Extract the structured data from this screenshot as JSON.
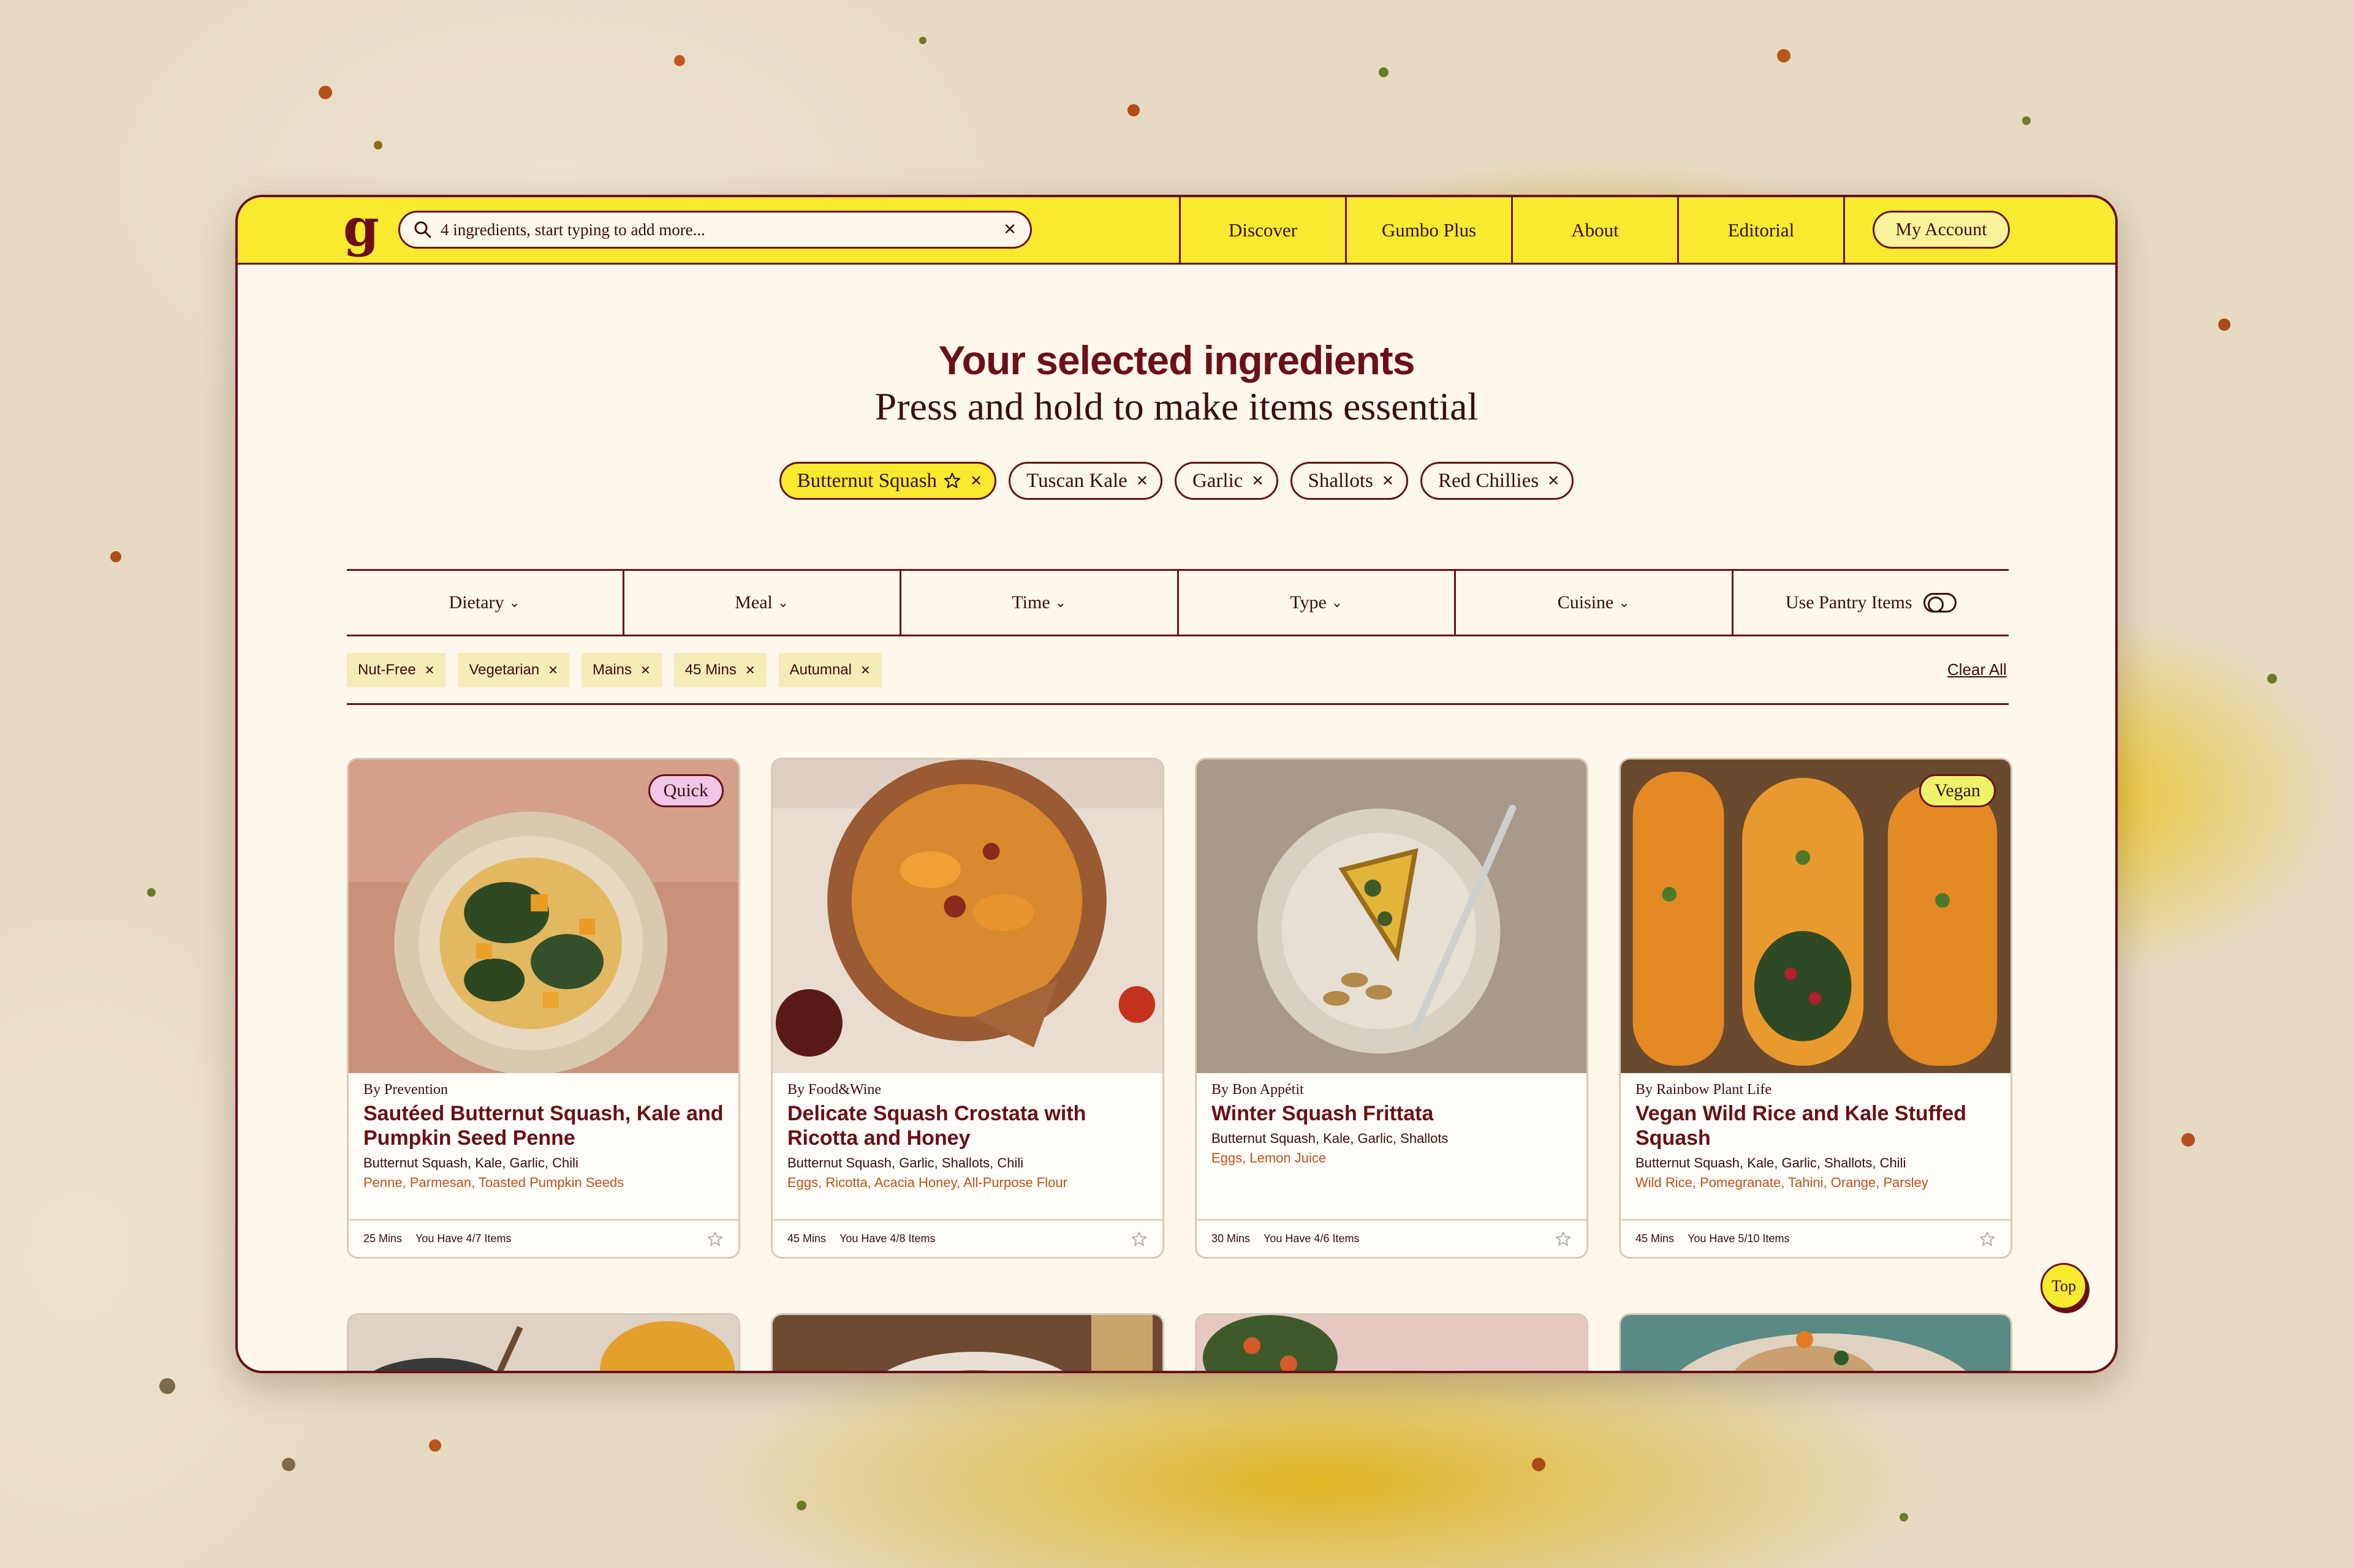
{
  "app": {
    "logo": "g",
    "search_placeholder": "4 ingredients, start typing to add more...",
    "nav": [
      "Discover",
      "Gumbo Plus",
      "About",
      "Editorial"
    ],
    "account_label": "My Account"
  },
  "main": {
    "heading": "Your selected ingredients",
    "subheading": "Press and hold to make items essential",
    "ingredients": [
      {
        "label": "Butternut Squash",
        "essential": true
      },
      {
        "label": "Tuscan Kale"
      },
      {
        "label": "Garlic"
      },
      {
        "label": "Shallots"
      },
      {
        "label": "Red Chillies"
      }
    ],
    "filters": [
      "Dietary",
      "Meal",
      "Time",
      "Type",
      "Cuisine"
    ],
    "pantry_label": "Use Pantry Items",
    "active_tags": [
      "Nut-Free",
      "Vegetarian",
      "Mains",
      "45 Mins",
      "Autumnal"
    ],
    "clear_all": "Clear All",
    "top_label": "Top"
  },
  "recipes": [
    {
      "badge": "Quick",
      "by": "By Prevention",
      "title": "Sautéed Butternut Squash, Kale and Pumpkin Seed Penne",
      "ingredients": "Butternut Squash, Kale, Garlic, Chili",
      "extra": "Penne, Parmesan, Toasted Pumpkin Seeds",
      "time": "25 Mins",
      "have": "You Have 4/7 Items"
    },
    {
      "badge": "",
      "by": "By Food&Wine",
      "title": "Delicate Squash Crostata with Ricotta and Honey",
      "ingredients": "Butternut Squash, Garlic, Shallots, Chili",
      "extra": "Eggs, Ricotta, Acacia Honey, All-Purpose Flour",
      "time": "45 Mins",
      "have": "You Have 4/8 Items"
    },
    {
      "badge": "",
      "by": "By Bon Appétit",
      "title": "Winter Squash Frittata",
      "ingredients": "Butternut Squash, Kale, Garlic, Shallots",
      "extra": "Eggs, Lemon Juice",
      "time": "30 Mins",
      "have": "You Have 4/6 Items"
    },
    {
      "badge": "Vegan",
      "by": "By Rainbow Plant Life",
      "title": "Vegan Wild Rice and Kale Stuffed Squash",
      "ingredients": "Butternut Squash, Kale, Garlic, Shallots, Chili",
      "extra": "Wild Rice, Pomegranate, Tahini, Orange, Parsley",
      "time": "45 Mins",
      "have": "You Have 5/10 Items"
    }
  ]
}
